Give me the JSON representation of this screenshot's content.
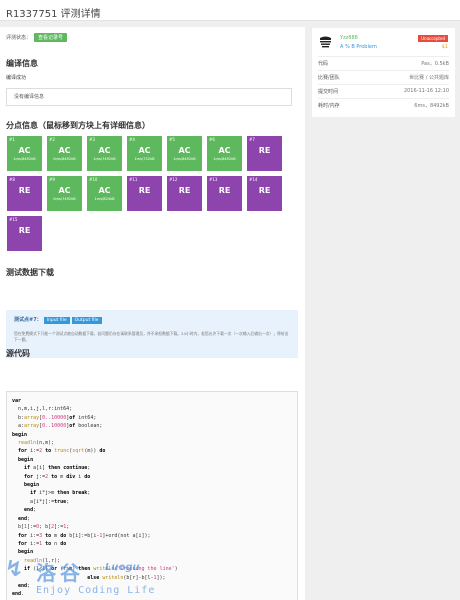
{
  "page_title": "R1337751 评测详情",
  "status": {
    "label": "评测状态：",
    "value": "查看记录号"
  },
  "compile": {
    "heading": "编译信息",
    "subheading": "编译成功",
    "message": "没有编译信息"
  },
  "cases": {
    "heading": "分点信息（鼠标移到方块上有详细信息）",
    "items": [
      {
        "index": "#1",
        "result": "AC",
        "info": "1ms/8492kB",
        "status": "ac"
      },
      {
        "index": "#2",
        "result": "AC",
        "info": "0ms/8492kB",
        "status": "ac"
      },
      {
        "index": "#3",
        "result": "AC",
        "info": "1ms/7492kB",
        "status": "ac"
      },
      {
        "index": "#4",
        "result": "AC",
        "info": "1ms/752kB",
        "status": "ac"
      },
      {
        "index": "#5",
        "result": "AC",
        "info": "1ms/8492kB",
        "status": "ac"
      },
      {
        "index": "#6",
        "result": "AC",
        "info": "1ms/8492kB",
        "status": "ac"
      },
      {
        "index": "#7",
        "result": "RE",
        "info": "",
        "status": "re"
      },
      {
        "index": "#8",
        "result": "RE",
        "info": "",
        "status": "re"
      },
      {
        "index": "#9",
        "result": "AC",
        "info": "0ms/7492kB",
        "status": "ac"
      },
      {
        "index": "#10",
        "result": "AC",
        "info": "1ms/824kB",
        "status": "ac"
      },
      {
        "index": "#11",
        "result": "RE",
        "info": "",
        "status": "re"
      },
      {
        "index": "#12",
        "result": "RE",
        "info": "",
        "status": "re"
      },
      {
        "index": "#13",
        "result": "RE",
        "info": "",
        "status": "re"
      },
      {
        "index": "#14",
        "result": "RE",
        "info": "",
        "status": "re"
      },
      {
        "index": "#15",
        "result": "RE",
        "info": "",
        "status": "re"
      }
    ]
  },
  "download": {
    "heading": "测试数据下载",
    "point_label": "测试点#7：",
    "input_btn": "Input file",
    "output_btn": "Output file",
    "note": "您在免费模式下只能一个测试点被自动数据下载，若问题仍存在请联系管理员，并不承担数据下载。24小时内，若您允许下载一次（一次输入后输出一次），将给出下一题。"
  },
  "source": {
    "heading": "源代码"
  },
  "sidebar": {
    "user": "Yzz888",
    "problem": "A % B Problem",
    "badge": "Unaccepted",
    "score": "$1",
    "rows": [
      {
        "key": "代码",
        "value": "Pas，0.5kB"
      },
      {
        "key": "比赛/团队",
        "value": "世比赛 / 公共题库"
      },
      {
        "key": "提交时间",
        "value": "2016-11-16 12:10"
      },
      {
        "key": "耗时/内存",
        "value": "6ms，8492kB"
      }
    ]
  },
  "watermark": {
    "cn": "洛谷",
    "en": "Luogu",
    "slogan": "Enjoy Coding Life"
  },
  "colors": {
    "ac": "#5eb95e",
    "re": "#8e44ad",
    "link": "#3498db",
    "badge": "#e74c3c"
  }
}
